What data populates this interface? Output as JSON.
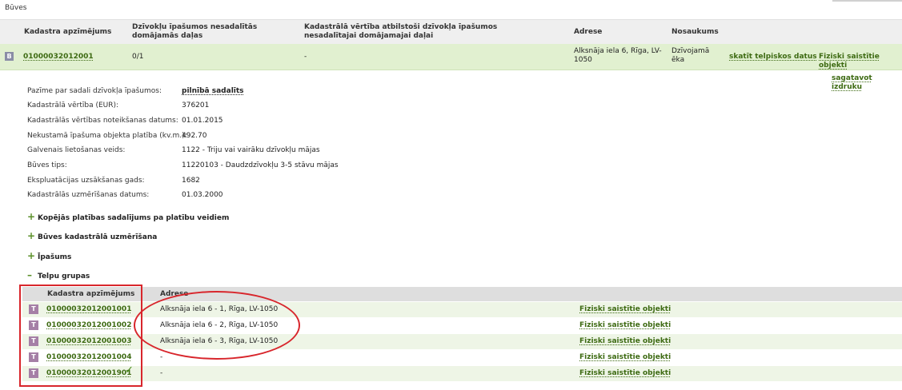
{
  "section_title": "Būves",
  "building_table": {
    "headers": {
      "cadastre": "Kadastra apzīmējums",
      "shares": "Dzīvokļu īpašumos nesadalītās domājamās daļas",
      "value": "Kadastrālā vērtība atbilstoši dzīvokļa īpašumos nesadalītajai domājamajai daļai",
      "address": "Adrese",
      "name": "Nosaukums"
    },
    "row": {
      "badge": "B",
      "cadastre": "01000032012001",
      "shares": "0/1",
      "value": "-",
      "address": "Alksnāja iela 6, Rīga, LV-1050",
      "name": "Dzīvojamā ēka",
      "link_spatial": "skatīt telpiskos datus",
      "link_physical": "Fiziski saistītie objekti"
    }
  },
  "print_link": "sagatavot izdruku",
  "details": [
    {
      "label": "Pazīme par sadali dzīvokļa īpašumos:",
      "value": "pilnībā sadalīts",
      "is_link": true
    },
    {
      "label": "Kadastrālā vērtība (EUR):",
      "value": "376201"
    },
    {
      "label": "Kadastrālās vērtības noteikšanas datums:",
      "value": "01.01.2015"
    },
    {
      "label": "Nekustamā īpašuma objekta platība (kv.m.):",
      "value": "492.70"
    },
    {
      "label": "Galvenais lietošanas veids:",
      "value": "1122 - Triju vai vairāku dzīvokļu mājas"
    },
    {
      "label": "Būves tips:",
      "value": "11220103 - Daudzdzīvokļu 3-5 stāvu mājas"
    },
    {
      "label": "Ekspluatācijas uzsākšanas gads:",
      "value": "1682"
    },
    {
      "label": "Kadastrālās uzmērīšanas datums:",
      "value": "01.03.2000"
    }
  ],
  "expanders": [
    {
      "sign": "+",
      "label": "Kopējās platības sadalījums pa platību veidiem"
    },
    {
      "sign": "+",
      "label": "Būves kadastrālā uzmērīšana"
    },
    {
      "sign": "+",
      "label": "Īpašums"
    },
    {
      "sign": "–",
      "label": "Telpu grupas"
    }
  ],
  "groups_table": {
    "headers": {
      "cadastre": "Kadastra apzīmējums",
      "address": "Adrese"
    },
    "rows": [
      {
        "badge": "T",
        "cadastre": "01000032012001001",
        "address": "Alksnāja iela 6 - 1, Rīga, LV-1050",
        "link": "Fiziski saistītie objekti"
      },
      {
        "badge": "T",
        "cadastre": "01000032012001002",
        "address": "Alksnāja iela 6 - 2, Rīga, LV-1050",
        "link": "Fiziski saistītie objekti"
      },
      {
        "badge": "T",
        "cadastre": "01000032012001003",
        "address": "Alksnāja iela 6 - 3, Rīga, LV-1050",
        "link": "Fiziski saistītie objekti"
      },
      {
        "badge": "T",
        "cadastre": "01000032012001004",
        "address": "-",
        "link": "Fiziski saistītie objekti"
      },
      {
        "badge": "T",
        "cadastre": "01000032012001901",
        "address": "-",
        "link": "Fiziski saistītie objekti",
        "check": "✓"
      }
    ]
  },
  "colors": {
    "link_green": "#3d6a12",
    "row_green": "#e1f0d0",
    "annotation_red": "#d8262c"
  }
}
